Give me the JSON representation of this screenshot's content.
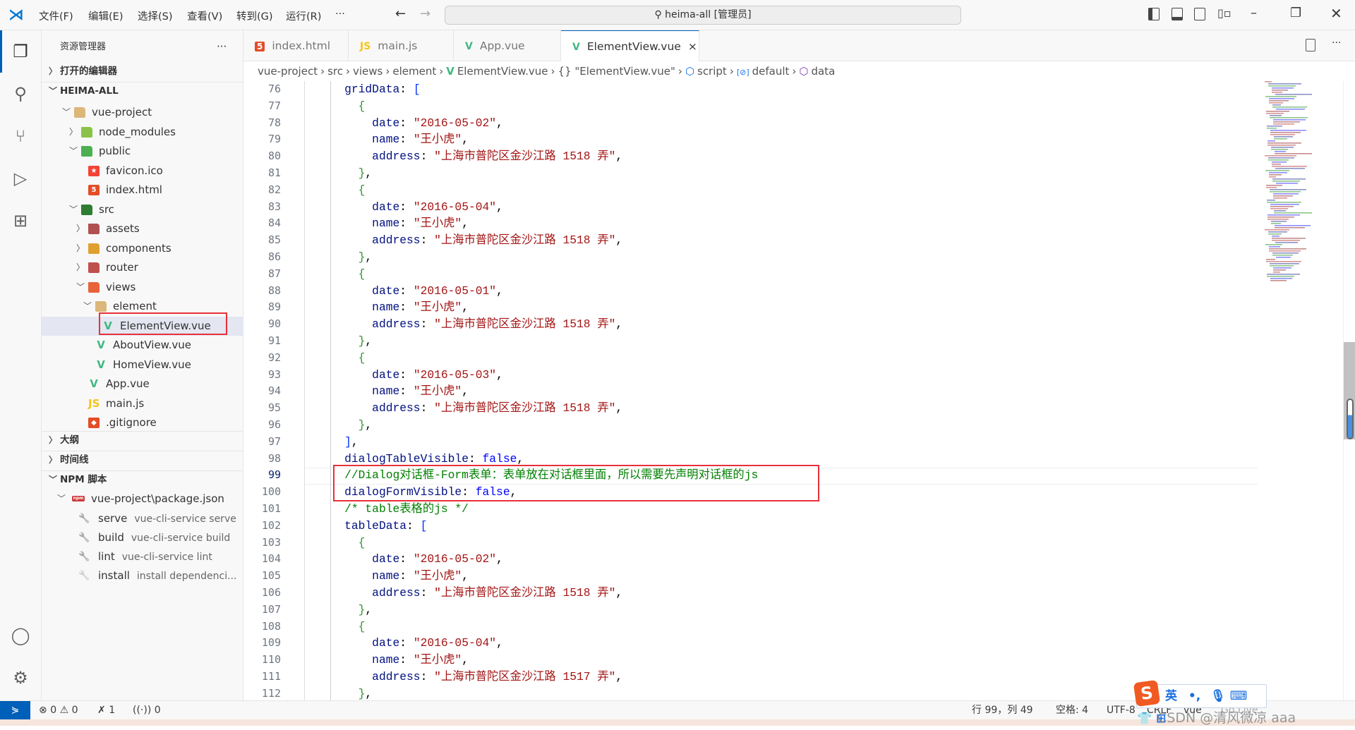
{
  "titlebar": {
    "menus": [
      "文件(F)",
      "编辑(E)",
      "选择(S)",
      "查看(V)",
      "转到(G)",
      "运行(R)",
      "···"
    ],
    "search": "heima-all [管理员]",
    "back": "←",
    "forward": "→"
  },
  "sidebar": {
    "title": "资源管理器",
    "more": "···",
    "open_editors": "打开的编辑器",
    "root": "HEIMA-ALL",
    "tree": [
      {
        "label": "vue-project",
        "depth": 1,
        "chev": "v",
        "icon": "folder",
        "color": "#dcb67a"
      },
      {
        "label": "node_modules",
        "depth": 2,
        "chev": ">",
        "icon": "folder-node",
        "color": "#8bc34a"
      },
      {
        "label": "public",
        "depth": 2,
        "chev": "v",
        "icon": "folder-public",
        "color": "#4caf50"
      },
      {
        "label": "favicon.ico",
        "depth": 3,
        "chev": "",
        "icon": "star",
        "color": "#f44336"
      },
      {
        "label": "index.html",
        "depth": 3,
        "chev": "",
        "icon": "html5",
        "color": "#e44d26"
      },
      {
        "label": "src",
        "depth": 2,
        "chev": "v",
        "icon": "folder-src",
        "color": "#2e7d32"
      },
      {
        "label": "assets",
        "depth": 3,
        "chev": ">",
        "icon": "folder-assets",
        "color": "#b05050"
      },
      {
        "label": "components",
        "depth": 3,
        "chev": ">",
        "icon": "folder-components",
        "color": "#e0a030"
      },
      {
        "label": "router",
        "depth": 3,
        "chev": ">",
        "icon": "folder-router",
        "color": "#c0504d"
      },
      {
        "label": "views",
        "depth": 3,
        "chev": "v",
        "icon": "folder-views",
        "color": "#e8623a"
      },
      {
        "label": "element",
        "depth": 4,
        "chev": "v",
        "icon": "folder",
        "color": "#dcb67a"
      },
      {
        "label": "ElementView.vue",
        "depth": 5,
        "chev": "",
        "icon": "vue",
        "color": "#41b883",
        "selected": true
      },
      {
        "label": "AboutView.vue",
        "depth": 4,
        "chev": "",
        "icon": "vue",
        "color": "#41b883"
      },
      {
        "label": "HomeView.vue",
        "depth": 4,
        "chev": "",
        "icon": "vue",
        "color": "#41b883"
      },
      {
        "label": "App.vue",
        "depth": 3,
        "chev": "",
        "icon": "vue",
        "color": "#41b883"
      },
      {
        "label": "main.js",
        "depth": 3,
        "chev": "",
        "icon": "js",
        "color": "#f5c518"
      },
      {
        "label": ".gitignore",
        "depth": 3,
        "chev": "",
        "icon": "git",
        "color": "#e44d26"
      }
    ],
    "outline": "大纲",
    "timeline": "时间线",
    "npm": "NPM 脚本",
    "npm_package": "vue-project\\package.json",
    "scripts": [
      {
        "name": "serve",
        "cmd": "vue-cli-service serve"
      },
      {
        "name": "build",
        "cmd": "vue-cli-service build"
      },
      {
        "name": "lint",
        "cmd": "vue-cli-service lint"
      },
      {
        "name": "install",
        "cmd": "install dependenci..."
      }
    ]
  },
  "tabs": [
    {
      "label": "index.html",
      "icon": "html5",
      "color": "#e44d26"
    },
    {
      "label": "main.js",
      "icon": "js",
      "color": "#f5c518"
    },
    {
      "label": "App.vue",
      "icon": "vue",
      "color": "#41b883"
    },
    {
      "label": "ElementView.vue",
      "icon": "vue",
      "color": "#41b883",
      "active": true,
      "close": "×"
    }
  ],
  "breadcrumb": [
    "vue-project",
    "src",
    "views",
    "element",
    "ElementView.vue",
    "{} \"ElementView.vue\"",
    "script",
    "default",
    "data"
  ],
  "editor": {
    "current_line": 99,
    "lines": [
      {
        "n": "76",
        "i": 4,
        "seg": [
          [
            "k",
            "gridData"
          ],
          [
            "p",
            ": "
          ],
          [
            "b1",
            "["
          ]
        ]
      },
      {
        "n": "77",
        "i": 6,
        "seg": [
          [
            "b2",
            "{"
          ]
        ]
      },
      {
        "n": "78",
        "i": 8,
        "seg": [
          [
            "k",
            "date"
          ],
          [
            "p",
            ": "
          ],
          [
            "s",
            "\"2016-05-02\""
          ],
          [
            "p",
            ","
          ]
        ]
      },
      {
        "n": "79",
        "i": 8,
        "seg": [
          [
            "k",
            "name"
          ],
          [
            "p",
            ": "
          ],
          [
            "s",
            "\"王小虎\""
          ],
          [
            "p",
            ","
          ]
        ]
      },
      {
        "n": "80",
        "i": 8,
        "seg": [
          [
            "k",
            "address"
          ],
          [
            "p",
            ": "
          ],
          [
            "s",
            "\"上海市普陀区金沙江路 1518 弄\""
          ],
          [
            "p",
            ","
          ]
        ]
      },
      {
        "n": "81",
        "i": 6,
        "seg": [
          [
            "b2",
            "}"
          ],
          [
            "p",
            ","
          ]
        ]
      },
      {
        "n": "82",
        "i": 6,
        "seg": [
          [
            "b2",
            "{"
          ]
        ]
      },
      {
        "n": "83",
        "i": 8,
        "seg": [
          [
            "k",
            "date"
          ],
          [
            "p",
            ": "
          ],
          [
            "s",
            "\"2016-05-04\""
          ],
          [
            "p",
            ","
          ]
        ]
      },
      {
        "n": "84",
        "i": 8,
        "seg": [
          [
            "k",
            "name"
          ],
          [
            "p",
            ": "
          ],
          [
            "s",
            "\"王小虎\""
          ],
          [
            "p",
            ","
          ]
        ]
      },
      {
        "n": "85",
        "i": 8,
        "seg": [
          [
            "k",
            "address"
          ],
          [
            "p",
            ": "
          ],
          [
            "s",
            "\"上海市普陀区金沙江路 1518 弄\""
          ],
          [
            "p",
            ","
          ]
        ]
      },
      {
        "n": "86",
        "i": 6,
        "seg": [
          [
            "b2",
            "}"
          ],
          [
            "p",
            ","
          ]
        ]
      },
      {
        "n": "87",
        "i": 6,
        "seg": [
          [
            "b2",
            "{"
          ]
        ]
      },
      {
        "n": "88",
        "i": 8,
        "seg": [
          [
            "k",
            "date"
          ],
          [
            "p",
            ": "
          ],
          [
            "s",
            "\"2016-05-01\""
          ],
          [
            "p",
            ","
          ]
        ]
      },
      {
        "n": "89",
        "i": 8,
        "seg": [
          [
            "k",
            "name"
          ],
          [
            "p",
            ": "
          ],
          [
            "s",
            "\"王小虎\""
          ],
          [
            "p",
            ","
          ]
        ]
      },
      {
        "n": "90",
        "i": 8,
        "seg": [
          [
            "k",
            "address"
          ],
          [
            "p",
            ": "
          ],
          [
            "s",
            "\"上海市普陀区金沙江路 1518 弄\""
          ],
          [
            "p",
            ","
          ]
        ]
      },
      {
        "n": "91",
        "i": 6,
        "seg": [
          [
            "b2",
            "}"
          ],
          [
            "p",
            ","
          ]
        ]
      },
      {
        "n": "92",
        "i": 6,
        "seg": [
          [
            "b2",
            "{"
          ]
        ]
      },
      {
        "n": "93",
        "i": 8,
        "seg": [
          [
            "k",
            "date"
          ],
          [
            "p",
            ": "
          ],
          [
            "s",
            "\"2016-05-03\""
          ],
          [
            "p",
            ","
          ]
        ]
      },
      {
        "n": "94",
        "i": 8,
        "seg": [
          [
            "k",
            "name"
          ],
          [
            "p",
            ": "
          ],
          [
            "s",
            "\"王小虎\""
          ],
          [
            "p",
            ","
          ]
        ]
      },
      {
        "n": "95",
        "i": 8,
        "seg": [
          [
            "k",
            "address"
          ],
          [
            "p",
            ": "
          ],
          [
            "s",
            "\"上海市普陀区金沙江路 1518 弄\""
          ],
          [
            "p",
            ","
          ]
        ]
      },
      {
        "n": "96",
        "i": 6,
        "seg": [
          [
            "b2",
            "}"
          ],
          [
            "p",
            ","
          ]
        ]
      },
      {
        "n": "97",
        "i": 4,
        "seg": [
          [
            "b1",
            "]"
          ],
          [
            "p",
            ","
          ]
        ]
      },
      {
        "n": "98",
        "i": 4,
        "seg": [
          [
            "k",
            "dialogTableVisible"
          ],
          [
            "p",
            ": "
          ],
          [
            "kw",
            "false"
          ],
          [
            "p",
            ","
          ]
        ]
      },
      {
        "n": "99",
        "i": 4,
        "seg": [
          [
            "c",
            "//Dialog对话框-Form表单：表单放在对话框里面，所以需要先声明对话框的js"
          ]
        ]
      },
      {
        "n": "100",
        "i": 4,
        "seg": [
          [
            "k",
            "dialogFormVisible"
          ],
          [
            "p",
            ": "
          ],
          [
            "kw",
            "false"
          ],
          [
            "p",
            ","
          ]
        ]
      },
      {
        "n": "101",
        "i": 4,
        "seg": [
          [
            "c",
            "/* table表格的js */"
          ]
        ]
      },
      {
        "n": "102",
        "i": 4,
        "seg": [
          [
            "k",
            "tableData"
          ],
          [
            "p",
            ": "
          ],
          [
            "b1",
            "["
          ]
        ]
      },
      {
        "n": "103",
        "i": 6,
        "seg": [
          [
            "b2",
            "{"
          ]
        ]
      },
      {
        "n": "104",
        "i": 8,
        "seg": [
          [
            "k",
            "date"
          ],
          [
            "p",
            ": "
          ],
          [
            "s",
            "\"2016-05-02\""
          ],
          [
            "p",
            ","
          ]
        ]
      },
      {
        "n": "105",
        "i": 8,
        "seg": [
          [
            "k",
            "name"
          ],
          [
            "p",
            ": "
          ],
          [
            "s",
            "\"王小虎\""
          ],
          [
            "p",
            ","
          ]
        ]
      },
      {
        "n": "106",
        "i": 8,
        "seg": [
          [
            "k",
            "address"
          ],
          [
            "p",
            ": "
          ],
          [
            "s",
            "\"上海市普陀区金沙江路 1518 弄\""
          ],
          [
            "p",
            ","
          ]
        ]
      },
      {
        "n": "107",
        "i": 6,
        "seg": [
          [
            "b2",
            "}"
          ],
          [
            "p",
            ","
          ]
        ]
      },
      {
        "n": "108",
        "i": 6,
        "seg": [
          [
            "b2",
            "{"
          ]
        ]
      },
      {
        "n": "109",
        "i": 8,
        "seg": [
          [
            "k",
            "date"
          ],
          [
            "p",
            ": "
          ],
          [
            "s",
            "\"2016-05-04\""
          ],
          [
            "p",
            ","
          ]
        ]
      },
      {
        "n": "110",
        "i": 8,
        "seg": [
          [
            "k",
            "name"
          ],
          [
            "p",
            ": "
          ],
          [
            "s",
            "\"王小虎\""
          ],
          [
            "p",
            ","
          ]
        ]
      },
      {
        "n": "111",
        "i": 8,
        "seg": [
          [
            "k",
            "address"
          ],
          [
            "p",
            ": "
          ],
          [
            "s",
            "\"上海市普陀区金沙江路 1517 弄\""
          ],
          [
            "p",
            ","
          ]
        ]
      },
      {
        "n": "112",
        "i": 6,
        "seg": [
          [
            "b2",
            "}"
          ],
          [
            "p",
            ","
          ]
        ]
      }
    ]
  },
  "status": {
    "errors": "0",
    "warnings": "0",
    "ports": "1",
    "remote_count": "0",
    "position": "行 99，列 49",
    "spaces": "空格: 4",
    "encoding": "UTF-8",
    "eol": "CRLF",
    "language": "vue",
    "golive": "Go Live"
  },
  "ime": {
    "logo": "S",
    "lang": "英",
    "punct": "•,"
  },
  "watermark": "CSDN @清风微凉 aaa",
  "colors": {
    "accent": "#005fb8",
    "highlight": "#e8313a",
    "selected_row": "#e4e6f1"
  }
}
